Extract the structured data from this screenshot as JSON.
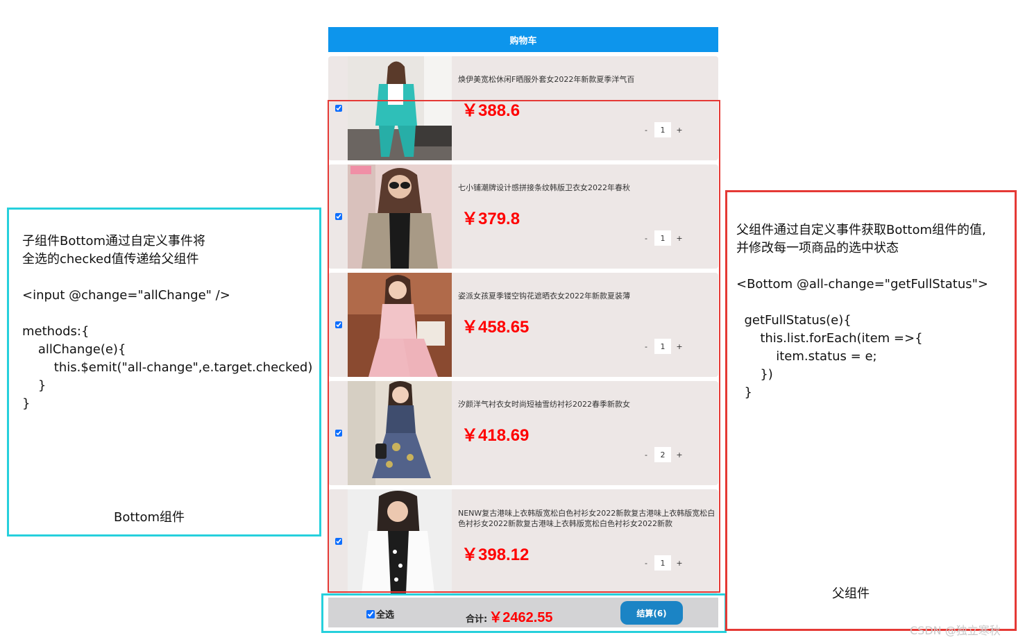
{
  "cart": {
    "header_title": "购物车",
    "currency": "￥",
    "items": [
      {
        "title": "焕伊美宽松休闲F晒服外套女2022年新款夏季洋气百",
        "price": "388.6",
        "qty": "1",
        "checked": true
      },
      {
        "title": "七小铺潮牌设计感拼接条纹韩版卫衣女2022年春秋",
        "price": "379.8",
        "qty": "1",
        "checked": true
      },
      {
        "title": "姿派女孩夏季镂空钩花遮晒衣女2022年新款夏装薄",
        "price": "458.65",
        "qty": "1",
        "checked": true
      },
      {
        "title": "汐颜洋气衬衣女时尚短袖雪纺衬衫2022春季新款女",
        "price": "418.69",
        "qty": "2",
        "checked": true
      },
      {
        "title": "NENW复古港味上衣韩版宽松白色衬衫女2022新款复古港味上衣韩版宽松白色衬衫女2022新款复古港味上衣韩版宽松白色衬衫女2022新款",
        "price": "398.12",
        "qty": "1",
        "checked": true
      }
    ],
    "minus_label": "-",
    "plus_label": "+"
  },
  "footer": {
    "select_all_label": "全选",
    "total_label": "合计:",
    "total_value": "￥2462.55",
    "checkout_label": "结算(6)"
  },
  "annotations": {
    "left_note": "子组件Bottom通过自定义事件将\n全选的checked值传递给父组件\n\n<input @change=\"allChange\" />\n\nmethods:{\n    allChange(e){\n        this.$emit(\"all-change\",e.target.checked)\n    }\n}",
    "left_caption": "Bottom组件",
    "right_note": "父组件通过自定义事件获取Bottom组件的值,\n并修改每一项商品的选中状态\n\n<Bottom @all-change=\"getFullStatus\">\n\n  getFullStatus(e){\n      this.list.forEach(item =>{\n          item.status = e;\n      })\n  }",
    "right_caption": "父组件",
    "watermark": "CSDN @独立寒秋"
  },
  "colors": {
    "header_blue": "#0d95ec",
    "price_red": "#ff0000",
    "frame_red": "#e53935",
    "frame_cyan": "#26d0dc",
    "checkout_blue": "#1b84c5"
  }
}
